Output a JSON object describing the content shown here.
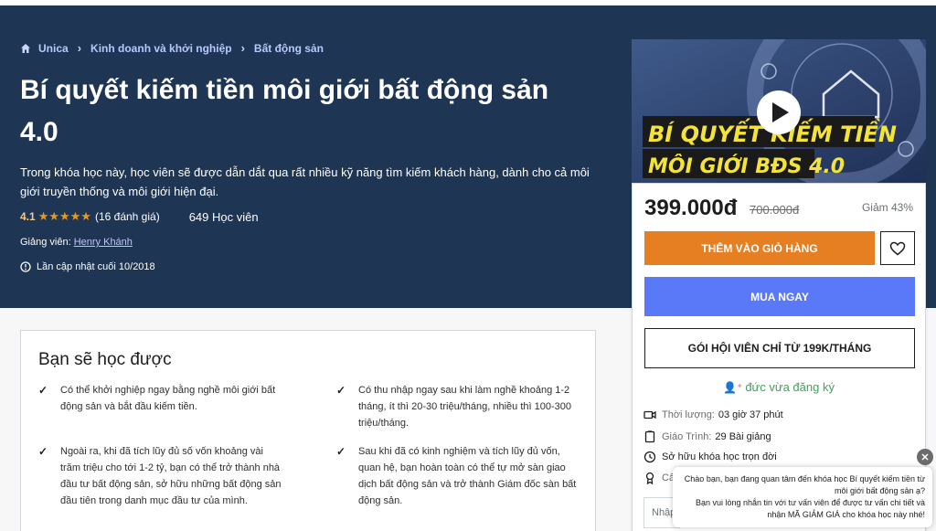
{
  "breadcrumb": {
    "items": [
      "Unica",
      "Kinh doanh và khởi nghiệp",
      "Bất động sản"
    ]
  },
  "course": {
    "title_line1": "Bí quyết kiếm tiền môi giới bất động sản",
    "title_line2": "4.0",
    "description": "Trong khóa học này, học viên sẽ được dẫn dắt qua rất nhiều kỹ năng tìm kiếm khách hàng, dành cho cả môi giới truyền thống và môi giới hiện đại.",
    "rating": "4.1",
    "stars": "★★★★★",
    "rating_count": "(16 đánh giá)",
    "students": "649 Học viên",
    "instructor_label": "Giảng viên: ",
    "instructor_name": "Henry Khánh",
    "updated": "Lần cập nhật cuối 10/2018"
  },
  "learn": {
    "title": "Bạn sẽ học được",
    "items": [
      "Có thể khởi nghiệp ngay bằng nghề môi giới bất động sản và bắt đầu kiếm tiền.",
      "Có thu nhập ngay sau khi làm nghề  khoảng 1-2 tháng, ít thì 20-30 triệu/tháng, nhiều thì 100-300 triệu/tháng.",
      "Ngoài ra, khi đã tích lũy đủ số vốn khoảng vài trăm triệu cho tới 1-2 tỷ, bạn có thể trở thành nhà đầu tư bất động sản, sở hữu những bất động sản đầu tiên trong danh mục đầu tư của mình.",
      " Sau khi đã có kinh nghiệm và tích lũy đủ vốn, quan hệ, bạn hoàn toàn có thể tự mở sàn giao dịch bất động sản và trở thành Giám đốc sàn bất động sản."
    ]
  },
  "video": {
    "banner_line1": "BÍ QUYẾT KIẾM TIỀN",
    "banner_line2": "MÔI GIỚI BĐS 4.0"
  },
  "purchase": {
    "price": "399.000đ",
    "old_price": "700.000đ",
    "discount": "Giảm 43%",
    "cart_label": "THÊM VÀO GIỎ HÀNG",
    "buy_label": "MUA NGAY",
    "member_label": "GÓI HỘI VIÊN CHỈ TỪ 199K/THÁNG",
    "registered": "đức vừa đăng ký",
    "features": [
      {
        "label": "Thời lượng:",
        "value": "03 giờ 37 phút"
      },
      {
        "label": "Giáo Trình:",
        "value": "29 Bài giảng"
      },
      {
        "label": "",
        "value": "Sở hữu khóa học trọn đời"
      },
      {
        "label": "Cấ",
        "value": ""
      }
    ],
    "input_placeholder": "Nhập"
  },
  "chat": {
    "line1": "Chào bạn, bạn đang quan tâm đến khóa học Bí quyết kiếm tiền từ môi giới bất động sản ạ?",
    "line2": "Bạn vui lòng nhắn tin với tư vấn viên để được tư vấn chi tiết và nhận MÃ GIẢM GIÁ cho khóa học này nhé!",
    "close": "✕"
  },
  "colors": {
    "hero_bg": "#1e3553",
    "cart": "#e67e22",
    "buy": "#5a79f9",
    "star": "#e59819"
  }
}
